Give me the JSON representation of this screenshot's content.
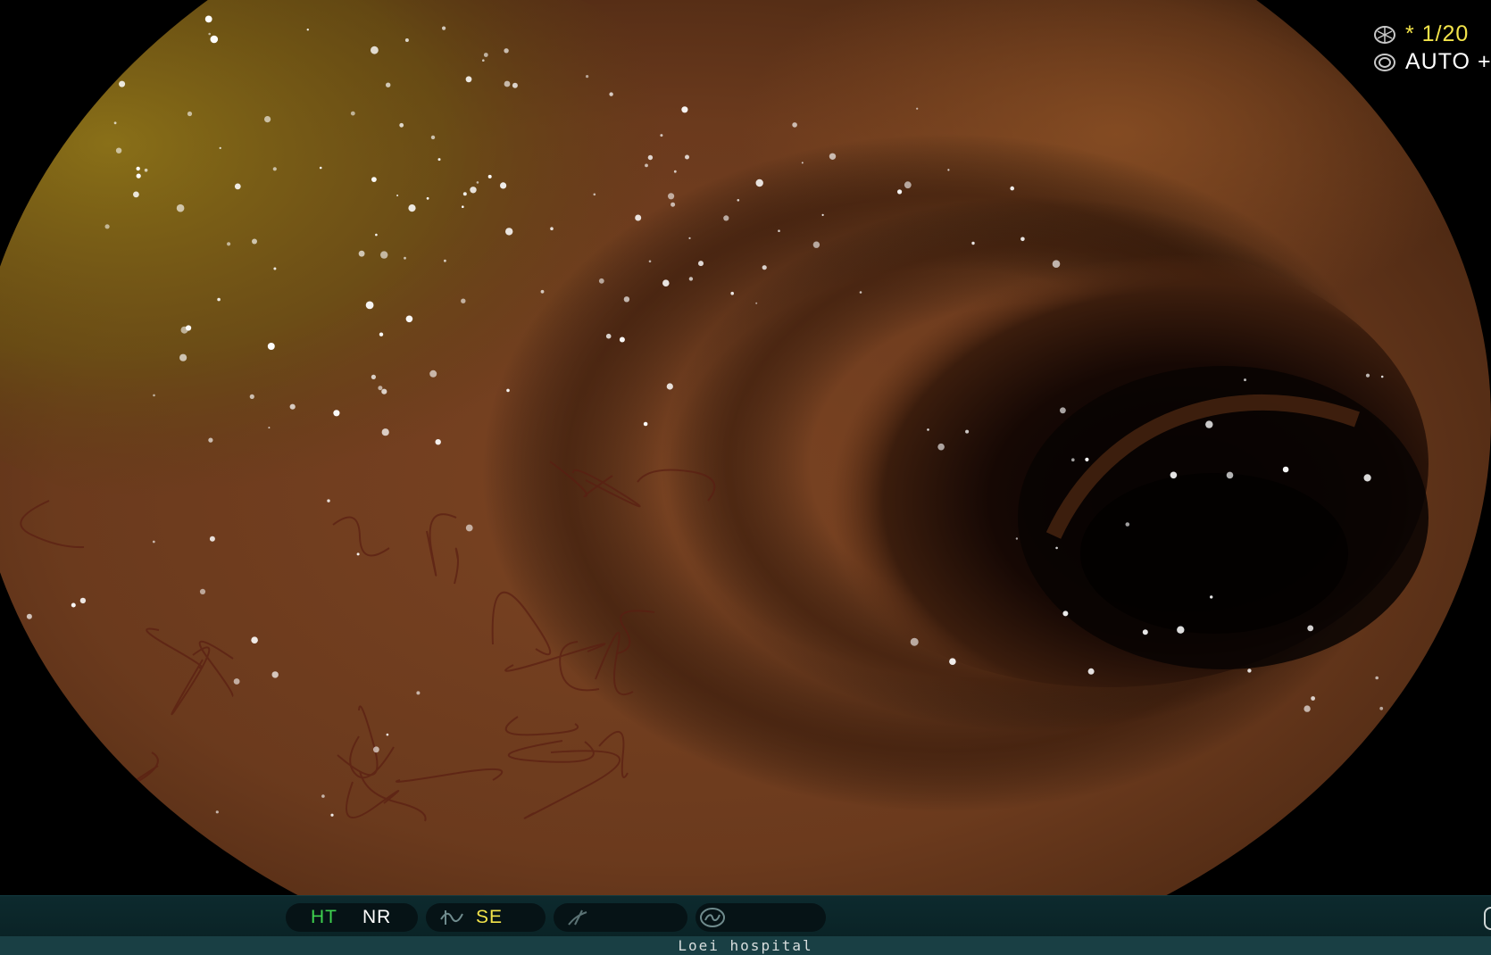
{
  "overlay": {
    "shutter_value": "* 1/20",
    "exposure_value": "AUTO +",
    "shutter_icon": "aperture-icon",
    "exposure_icon": "iris-icon",
    "text_color_primary": "#f2e34a",
    "text_color_secondary": "#ffffff"
  },
  "status_bar": {
    "ht_label": "HT",
    "nr_label": "NR",
    "se_label": "SE",
    "ht_color": "#3fd24f",
    "nr_color": "#ffffff",
    "se_color": "#f2e34a",
    "structure_icon": "structure-enhance-icon",
    "color_icon": "color-enhance-icon",
    "iris_icon": "light-mode-icon"
  },
  "footer": {
    "institution": "Loei hospital",
    "text_color": "#d8dede"
  },
  "scene": {
    "subject": "endoscopic-lumen",
    "tissue_color": "#6e3a1c",
    "lumen_color": "#0c0402",
    "bubble_tint": "#7a6414"
  }
}
